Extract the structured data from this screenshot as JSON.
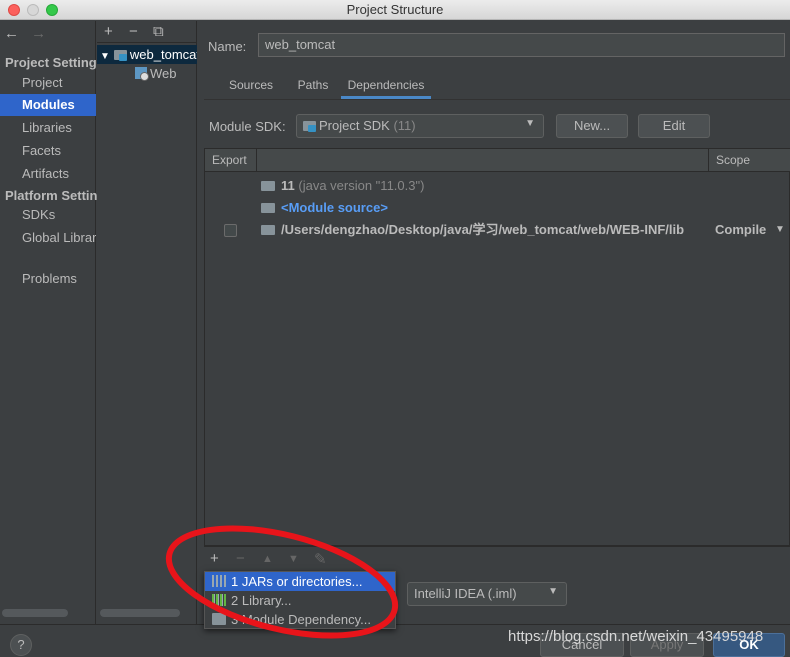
{
  "window": {
    "title": "Project Structure",
    "nav_back": "←",
    "nav_forward": "→"
  },
  "sidebar": {
    "project_settings_header": "Project Settings",
    "platform_settings_header": "Platform Settings",
    "items": [
      {
        "label": "Project"
      },
      {
        "label": "Modules"
      },
      {
        "label": "Libraries"
      },
      {
        "label": "Facets"
      },
      {
        "label": "Artifacts"
      },
      {
        "label": "SDKs"
      },
      {
        "label": "Global Libraries"
      },
      {
        "label": "Problems"
      }
    ],
    "selected": "Modules"
  },
  "module_tree": {
    "add": "+",
    "remove": "−",
    "copy": "⧉",
    "expand_arrow": "▼",
    "nodes": [
      {
        "label": "web_tomcat"
      },
      {
        "label": "Web"
      }
    ]
  },
  "main": {
    "name_label": "Name:",
    "name_value": "web_tomcat",
    "tabs": [
      {
        "label": "Sources"
      },
      {
        "label": "Paths"
      },
      {
        "label": "Dependencies"
      }
    ],
    "active_tab": "Dependencies",
    "module_sdk_label": "Module SDK:",
    "sdk_value": "Project SDK",
    "sdk_version": "(11)",
    "new_button": "New...",
    "edit_button": "Edit",
    "table": {
      "col_export": "Export",
      "col_scope": "Scope",
      "rows": [
        {
          "name": "11",
          "detail": "(java version \"11.0.3\")",
          "scope": ""
        },
        {
          "name": "<Module source>",
          "detail": "",
          "scope": ""
        },
        {
          "name": "/Users/dengzhao/Desktop/java/学习/web_tomcat/web/WEB-INF/lib",
          "detail": "",
          "scope": "Compile"
        }
      ]
    },
    "toolbar": {
      "add": "+",
      "remove": "−",
      "up": "▲",
      "down": "▼",
      "edit": "✎"
    },
    "format_value": "IntelliJ IDEA (.iml)"
  },
  "popup_menu": {
    "items": [
      {
        "label": "1  JARs or directories..."
      },
      {
        "label": "2  Library..."
      },
      {
        "label": "3  Module Dependency..."
      }
    ]
  },
  "footer": {
    "help": "?",
    "cancel": "Cancel",
    "apply": "Apply",
    "ok": "OK"
  },
  "watermark": "https://blog.csdn.net/weixin_43495948",
  "colors": {
    "selection": "#2f65ca",
    "link": "#589df6",
    "annotation": "#e8141a"
  }
}
